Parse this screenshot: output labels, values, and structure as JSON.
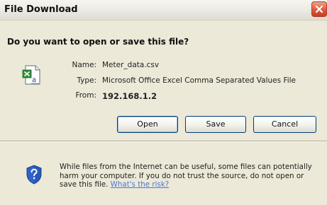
{
  "window": {
    "title": "File Download"
  },
  "dialog": {
    "question": "Do you want to open or save this file?",
    "file": {
      "name_label": "Name:",
      "name_value": "Meter_data.csv",
      "type_label": "Type:",
      "type_value": "Microsoft Office Excel Comma Separated Values File",
      "from_label": "From:",
      "from_value": "192.168.1.2"
    },
    "buttons": {
      "open": "Open",
      "save": "Save",
      "cancel": "Cancel"
    },
    "warning": {
      "text": "While files from the Internet can be useful, some files can potentially harm your computer. If you do not trust the source, do not open or save this file. ",
      "link": "What's the risk?"
    }
  },
  "icons": {
    "file": "excel-csv-file-icon",
    "warning": "shield-question-icon",
    "close": "close-icon"
  },
  "colors": {
    "window_background": "#ece9d8",
    "close_button": "#e0573a",
    "link": "#4a78d6",
    "button_border": "#003c74"
  }
}
